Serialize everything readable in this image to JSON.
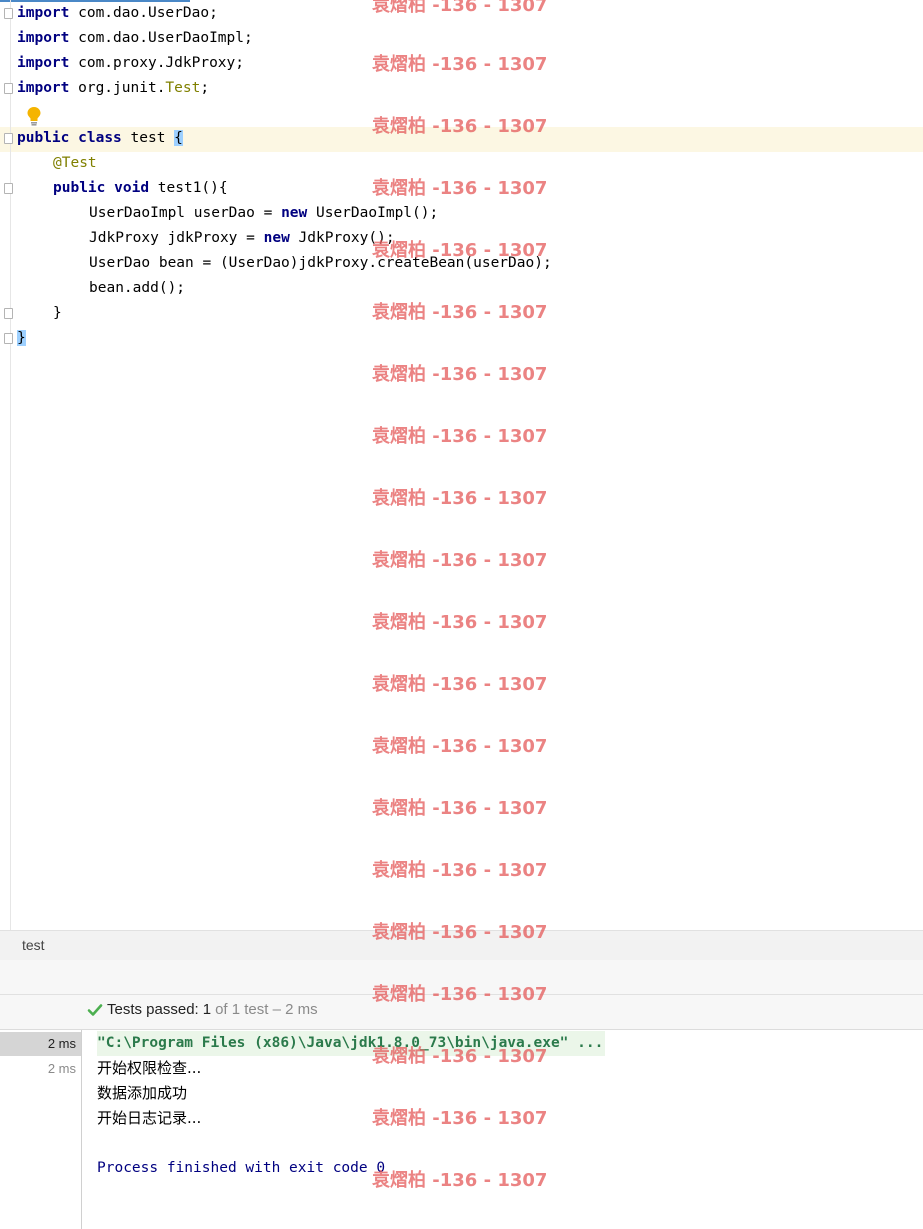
{
  "editor": {
    "lines": {
      "l1": {
        "kw": "import",
        "rest": " com.dao.UserDao;"
      },
      "l2": {
        "kw": "import",
        "rest": " com.dao.UserDaoImpl;"
      },
      "l3": {
        "kw": "import",
        "rest": " com.proxy.JdkProxy;"
      },
      "l4": {
        "kw": "import",
        "pre": " org.junit.",
        "cls": "Test",
        "post": ";"
      },
      "l6": {
        "kw1": "public",
        "kw2": "class",
        "name": " test ",
        "brace": "{"
      },
      "l7": {
        "annotation": "@Test"
      },
      "l8": {
        "kw1": "public",
        "kw2": "void",
        "rest": " test1(){"
      },
      "l9": {
        "pre": "UserDaoImpl userDao = ",
        "kw": "new",
        "post": " UserDaoImpl();"
      },
      "l10": {
        "pre": "JdkProxy jdkProxy = ",
        "kw": "new",
        "post": " JdkProxy();"
      },
      "l11": {
        "text": "UserDao bean = (UserDao)jdkProxy.createBean(userDao);"
      },
      "l12": {
        "text": "bean.add();"
      },
      "l13": {
        "text": "}"
      },
      "l14": {
        "brace": "}"
      }
    }
  },
  "run": {
    "tab_label": "test",
    "status": {
      "prefix": "Tests passed:",
      "passed": "1",
      "suffix": "of 1 test – 2 ms"
    },
    "tree": [
      {
        "time": "2 ms"
      },
      {
        "time": "2 ms"
      }
    ],
    "console": {
      "command": "\"C:\\Program Files (x86)\\Java\\jdk1.8.0_73\\bin\\java.exe\" ...",
      "out1": "开始权限检查...",
      "out2": "数据添加成功",
      "out3": "开始日志记录...",
      "exit": "Process finished with exit code 0"
    }
  },
  "watermark": "袁熠柏 -136 - 1307",
  "colors": {
    "keyword": "#000080",
    "annotation": "#808000",
    "pass": "#4caf50",
    "watermark": "#e45a5a"
  }
}
